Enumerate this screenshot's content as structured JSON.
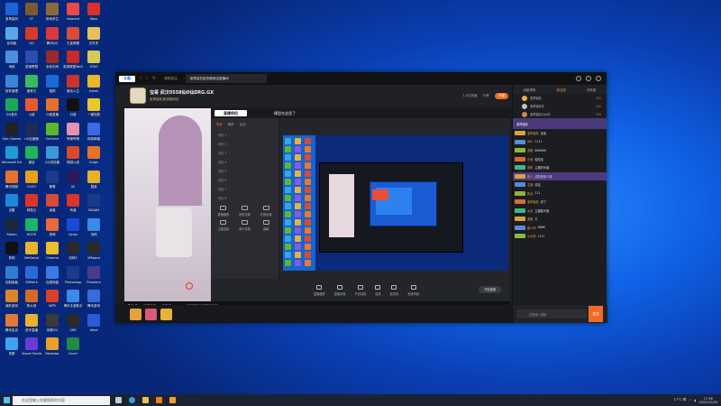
{
  "desktop": {
    "col1": [
      {
        "label": "宝哥装机",
        "color": "#1d63d8"
      },
      {
        "label": "此电脑",
        "color": "#5aa7e6"
      },
      {
        "label": "网络",
        "color": "#4c8fe0"
      },
      {
        "label": "软件管理",
        "color": "#3a86d6"
      },
      {
        "label": "QQ音乐",
        "color": "#1aa85a"
      },
      {
        "label": "Epic Games",
        "color": "#222"
      },
      {
        "label": "Microsoft Edge",
        "color": "#1f9bd6"
      },
      {
        "label": "腾讯视频",
        "color": "#e8722a"
      },
      {
        "label": "迅雷",
        "color": "#1a8ad8"
      },
      {
        "label": "Steam",
        "color": "#1b2838"
      },
      {
        "label": "剪映",
        "color": "#111"
      },
      {
        "label": "控制面板",
        "color": "#2f7dd1"
      },
      {
        "label": "我的游戏",
        "color": "#d8882a"
      },
      {
        "label": "腾讯会议",
        "color": "#e2793a"
      },
      {
        "label": "录屏",
        "color": "#3fa3f0"
      }
    ],
    "col2": [
      {
        "label": "CF",
        "color": "#7a5b2f"
      },
      {
        "label": "QQ",
        "color": "#d63a2a"
      },
      {
        "label": "英雄联盟",
        "color": "#2a4db0"
      },
      {
        "label": "爱奇艺",
        "color": "#3cba5c"
      },
      {
        "label": "火绒",
        "color": "#e85a2c"
      },
      {
        "label": "UU加速器",
        "color": "#1f2b58"
      },
      {
        "label": "微信",
        "color": "#1fb35a"
      },
      {
        "label": "CSGO",
        "color": "#e6a21a"
      },
      {
        "label": "网易云",
        "color": "#d8342c"
      },
      {
        "label": "KOOK",
        "color": "#1cb36a"
      },
      {
        "label": "WeGame",
        "color": "#e8b42a"
      },
      {
        "label": "3DMark",
        "color": "#2a6ad8"
      },
      {
        "label": "鲁大师",
        "color": "#d86a28"
      },
      {
        "label": "虎牙直播",
        "color": "#e8b12e"
      },
      {
        "label": "Visual Studio",
        "color": "#6a3ad6"
      }
    ],
    "col3": [
      {
        "label": "绝地求生",
        "color": "#8a6a3a"
      },
      {
        "label": "腾讯QQ",
        "color": "#d83a3a"
      },
      {
        "label": "永劫无间",
        "color": "#9a2a2a"
      },
      {
        "label": "酷狗",
        "color": "#1a6ad6"
      },
      {
        "label": "斗鱼直播",
        "color": "#e8702a"
      },
      {
        "label": "GeForce",
        "color": "#5cb82a"
      },
      {
        "label": "QQ浏览器",
        "color": "#3a9ad8"
      },
      {
        "label": "暴雪",
        "color": "#1a3a8a"
      },
      {
        "label": "逍遥",
        "color": "#d84a3a"
      },
      {
        "label": "原神",
        "color": "#e86a3a"
      },
      {
        "label": "Chrome",
        "color": "#e8c02a"
      },
      {
        "label": "百度网盘",
        "color": "#3a7ae8"
      },
      {
        "label": "WPS",
        "color": "#d8402a"
      },
      {
        "label": "网易UU",
        "color": "#3a3a3a"
      },
      {
        "label": "Rockstar",
        "color": "#e8a02a"
      }
    ],
    "col4": [
      {
        "label": "Valorant",
        "color": "#e84a4a"
      },
      {
        "label": "王者荣耀",
        "color": "#d84a3a"
      },
      {
        "label": "英雄联盟WeGame",
        "color": "#c82a2a"
      },
      {
        "label": "驱动人生",
        "color": "#c8342a"
      },
      {
        "label": "抖音",
        "color": "#111"
      },
      {
        "label": "哔哩哔哩",
        "color": "#e890b0"
      },
      {
        "label": "穿越火线",
        "color": "#d84a2a"
      },
      {
        "label": "AE",
        "color": "#2a1a5a"
      },
      {
        "label": "有道",
        "color": "#d8342a"
      },
      {
        "label": "Uplay",
        "color": "#1a4ad8"
      },
      {
        "label": "剑网3",
        "color": "#2a2a2a"
      },
      {
        "label": "Photoshop",
        "color": "#1a3a8a"
      },
      {
        "label": "腾讯手游助手",
        "color": "#3a8ae8"
      },
      {
        "label": "OBS",
        "color": "#2a2a2a"
      },
      {
        "label": "Excel",
        "color": "#1f8a4a"
      }
    ],
    "col5": [
      {
        "label": "Xbox",
        "color": "#d8302a"
      },
      {
        "label": "文件夹",
        "color": "#e8c05a"
      },
      {
        "label": "GTA5",
        "color": "#d8c85a"
      },
      {
        "label": "Xshell",
        "color": "#e8b82a"
      },
      {
        "label": "一键还原",
        "color": "#e8c82a"
      },
      {
        "label": "网易邮箱",
        "color": "#3a6ae8"
      },
      {
        "label": "Origin",
        "color": "#e8702a"
      },
      {
        "label": "酷我",
        "color": "#e8b02a"
      },
      {
        "label": "AIDA64",
        "color": "#1a3a8a"
      },
      {
        "label": "战网",
        "color": "#3a8ae8"
      },
      {
        "label": "VMware",
        "color": "#2a2a2a"
      },
      {
        "label": "Premiere",
        "color": "#4a3a8a"
      },
      {
        "label": "腾讯游戏",
        "color": "#3a6ad8"
      },
      {
        "label": "Word",
        "color": "#2a5ad8"
      }
    ]
  },
  "window": {
    "logo": "斗鱼",
    "back": "‹",
    "forward": "›",
    "refresh": "↻",
    "tab_inactive": "我的关注",
    "tab_active": "宝哥装机室攻略网站直播间",
    "tab_close": "×"
  },
  "room": {
    "title": "宝哥 武汉0558仙0仙DRG.GX",
    "subtitle": "宝哥装机室攻略网站",
    "follow": "+ 关注",
    "viewers": "1.4亿热度",
    "share": "分享",
    "btn": "开播"
  },
  "obs": {
    "logo": "直播伴侣",
    "title": "模型在这里了",
    "tabs": [
      "场景",
      "素材",
      "互动"
    ],
    "scenes": [
      "场景 1",
      "场景 2",
      "场景 3",
      "场景 4",
      "场景 5",
      "场景 6",
      "场景 7",
      "场景 8"
    ],
    "tools": [
      "直播截屏",
      "回放设置",
      "礼物设置",
      "主播连线",
      "音乐设置",
      "弹幕"
    ],
    "controls": [
      "直播截屏",
      "直播设置",
      "节目设置",
      "连线",
      "麦克风",
      "系统声音"
    ],
    "settings_btn": "开始直播"
  },
  "footer": {
    "speaker": "虎牙·你",
    "name": "宝哥装机",
    "line": "已开启",
    "notice": "主播直播间的直播内容"
  },
  "right": {
    "tabs": [
      "贡献周榜",
      "粉丝团",
      "贵宾席"
    ],
    "ranks": [
      {
        "name": "宝哥装机",
        "val": "101"
      },
      {
        "name": "宝哥装机中",
        "val": "102"
      },
      {
        "name": "宝哥装机小伙伴",
        "val": "103"
      }
    ],
    "chat_banner": "宝哥装机",
    "chats": [
      {
        "name": "宝哥装机",
        "msg": "加油",
        "color": "#d8a23a"
      },
      {
        "name": "ABC",
        "msg": "1111",
        "color": "#5a8ad8"
      },
      {
        "name": "游客",
        "msg": "666666",
        "color": "#8ab83a"
      },
      {
        "name": "小宝",
        "msg": "哈哈哈",
        "color": "#d86a3a"
      },
      {
        "name": "铁粉",
        "msg": "主播好厉害",
        "color": "#3ab88a"
      },
      {
        "name": "路人",
        "msg": "这配置多少钱",
        "color": "#d8a23a"
      },
      {
        "name": "主播",
        "msg": "欢迎",
        "color": "#5a8ad8"
      },
      {
        "name": "粉丝",
        "msg": "111",
        "color": "#8ab83a"
      },
      {
        "name": "宝哥装机",
        "msg": "来了",
        "color": "#d86a3a"
      },
      {
        "name": "水友",
        "msg": "主播能不能",
        "color": "#3ab88a"
      },
      {
        "name": "游客",
        "msg": "牛",
        "color": "#d8a23a"
      },
      {
        "name": "路人甲",
        "msg": "6666",
        "color": "#5a8ad8"
      },
      {
        "name": "小伙伴",
        "msg": "1111",
        "color": "#8ab83a"
      }
    ],
    "input_placeholder": "这里输入弹幕",
    "send": "发送"
  },
  "taskbar": {
    "search": "在这里输入你要搜索的内容",
    "tray_temp": "17°C 晴",
    "time": "17:36",
    "date": "2022/12/30"
  }
}
